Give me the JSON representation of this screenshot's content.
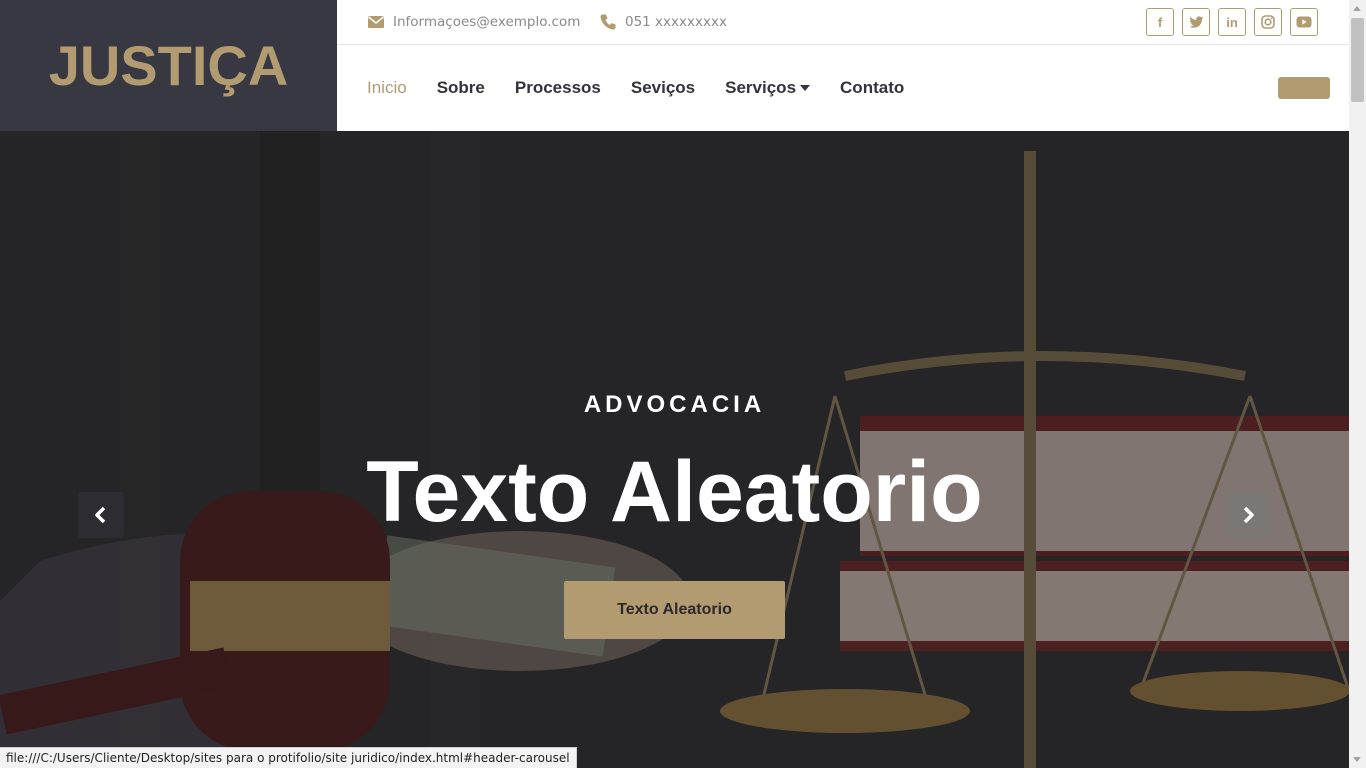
{
  "brand": {
    "logo_text": "JUSTIÇA"
  },
  "topbar": {
    "email": "Informaçoes@exemplo.com",
    "phone": "051 xxxxxxxxx",
    "socials": [
      {
        "name": "facebook-icon",
        "glyph": "f"
      },
      {
        "name": "twitter-icon",
        "glyph": "t"
      },
      {
        "name": "linkedin-icon",
        "glyph": "in"
      },
      {
        "name": "instagram-icon",
        "glyph": "◎"
      },
      {
        "name": "youtube-icon",
        "glyph": "▶"
      }
    ]
  },
  "nav": {
    "items": [
      {
        "label": "Inicio",
        "active": true
      },
      {
        "label": "Sobre"
      },
      {
        "label": "Processos"
      },
      {
        "label": "Seviços"
      },
      {
        "label": "Serviços",
        "dropdown": true
      },
      {
        "label": "Contato"
      }
    ]
  },
  "hero": {
    "kicker": "ADVOCACIA",
    "title": "Texto Aleatorio",
    "button_label": "Texto Aleatorio"
  },
  "status_bar": {
    "url": "file:///C:/Users/Cliente/Desktop/sites para o protifolio/site juridico/index.html#header-carousel"
  },
  "colors": {
    "accent": "#b39b71",
    "brand_bg": "#383842",
    "text_dark": "#33333d"
  }
}
